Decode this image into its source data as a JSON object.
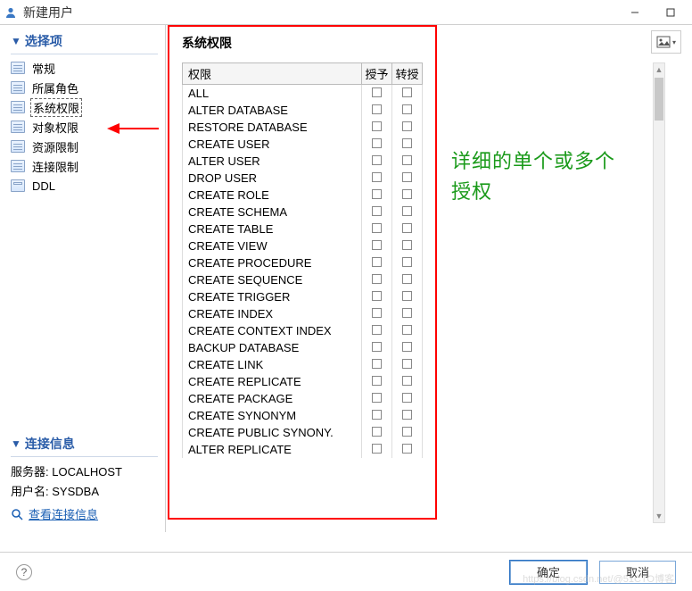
{
  "window": {
    "title": "新建用户"
  },
  "sidebar": {
    "section_options": "选择项",
    "items": [
      {
        "label": "常规"
      },
      {
        "label": "所属角色"
      },
      {
        "label": "系统权限"
      },
      {
        "label": "对象权限"
      },
      {
        "label": "资源限制"
      },
      {
        "label": "连接限制"
      },
      {
        "label": "DDL"
      }
    ],
    "selected_index": 2,
    "section_conn": "连接信息",
    "server_label": "服务器:",
    "server_value": "LOCALHOST",
    "user_label": "用户名:",
    "user_value": "SYSDBA",
    "view_conn_link": "查看连接信息"
  },
  "main": {
    "title": "系统权限",
    "columns": {
      "perm": "权限",
      "grant": "授予",
      "transfer": "转授"
    },
    "rows": [
      "ALL",
      "ALTER DATABASE",
      "RESTORE DATABASE",
      "CREATE USER",
      "ALTER USER",
      "DROP USER",
      "CREATE ROLE",
      "CREATE SCHEMA",
      "CREATE TABLE",
      "CREATE VIEW",
      "CREATE PROCEDURE",
      "CREATE SEQUENCE",
      "CREATE TRIGGER",
      "CREATE INDEX",
      "CREATE CONTEXT INDEX",
      "BACKUP DATABASE",
      "CREATE LINK",
      "CREATE REPLICATE",
      "CREATE PACKAGE",
      "CREATE SYNONYM",
      "CREATE PUBLIC SYNONY.",
      "ALTER REPLICATE"
    ]
  },
  "annotation": {
    "line1": "详细的单个或多个",
    "line2": "授权"
  },
  "footer": {
    "ok": "确定",
    "cancel": "取消",
    "help": "?"
  },
  "watermark": "https://blog.csdn.net/@51CTO博客"
}
